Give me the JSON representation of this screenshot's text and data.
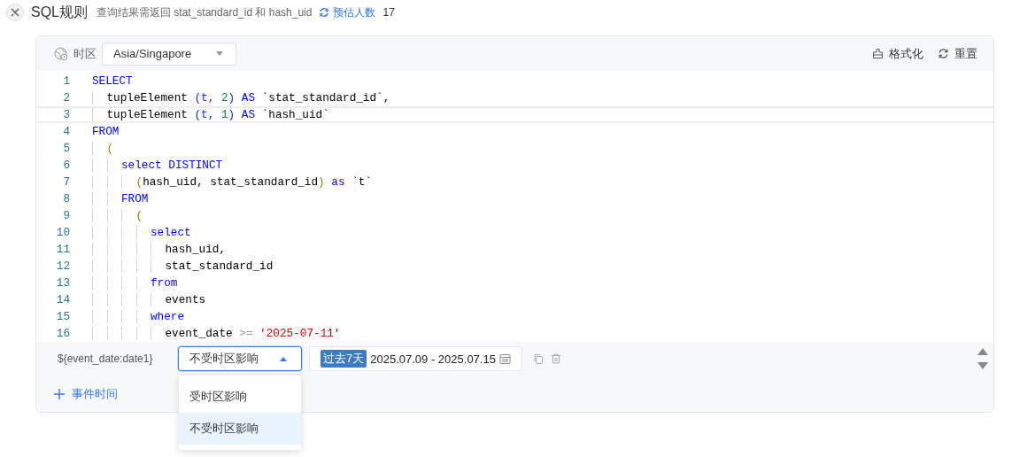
{
  "header": {
    "title": "SQL规则",
    "hint": "查询结果需返回 stat_standard_id 和 hash_uid",
    "estimate_link": "预估人数",
    "estimate_count": "17"
  },
  "toolbar": {
    "timezone_label": "时区",
    "timezone_value": "Asia/Singapore",
    "format_button": "格式化",
    "reset_button": "重置"
  },
  "code_lines": [
    {
      "number": "1",
      "current": false,
      "tokens": [
        {
          "kind": "kw",
          "text": "SELECT"
        }
      ]
    },
    {
      "number": "2",
      "current": false,
      "tokens": [
        {
          "kind": "plain",
          "text": "  tupleElement "
        },
        {
          "kind": "bracket",
          "text": "(t, "
        },
        {
          "kind": "num",
          "text": "2"
        },
        {
          "kind": "bracket",
          "text": ")"
        },
        {
          "kind": "kw",
          "text": " AS"
        },
        {
          "kind": "plain",
          "text": " `stat_standard_id`,"
        }
      ]
    },
    {
      "number": "3",
      "current": true,
      "tokens": [
        {
          "kind": "plain",
          "text": "  tupleElement "
        },
        {
          "kind": "bracket",
          "text": "(t, "
        },
        {
          "kind": "num",
          "text": "1"
        },
        {
          "kind": "bracket",
          "text": ")"
        },
        {
          "kind": "kw",
          "text": " AS"
        },
        {
          "kind": "plain",
          "text": " `hash_uid`"
        }
      ]
    },
    {
      "number": "4",
      "current": false,
      "tokens": [
        {
          "kind": "kw",
          "text": "FROM"
        }
      ]
    },
    {
      "number": "5",
      "current": false,
      "tokens": [
        {
          "kind": "paren",
          "text": "  ("
        }
      ]
    },
    {
      "number": "6",
      "current": false,
      "tokens": [
        {
          "kind": "kw",
          "text": "    select DISTINCT"
        }
      ]
    },
    {
      "number": "7",
      "current": false,
      "tokens": [
        {
          "kind": "paren",
          "text": "      ("
        },
        {
          "kind": "plain",
          "text": "hash_uid, stat_standard_id"
        },
        {
          "kind": "paren",
          "text": ")"
        },
        {
          "kind": "kw",
          "text": " as"
        },
        {
          "kind": "plain",
          "text": " `t`"
        }
      ]
    },
    {
      "number": "8",
      "current": false,
      "tokens": [
        {
          "kind": "kw",
          "text": "    FROM"
        }
      ]
    },
    {
      "number": "9",
      "current": false,
      "tokens": [
        {
          "kind": "paren",
          "text": "      ("
        }
      ]
    },
    {
      "number": "10",
      "current": false,
      "tokens": [
        {
          "kind": "kw",
          "text": "        select"
        }
      ]
    },
    {
      "number": "11",
      "current": false,
      "tokens": [
        {
          "kind": "plain",
          "text": "          hash_uid,"
        }
      ]
    },
    {
      "number": "12",
      "current": false,
      "tokens": [
        {
          "kind": "plain",
          "text": "          stat_standard_id"
        }
      ]
    },
    {
      "number": "13",
      "current": false,
      "tokens": [
        {
          "kind": "kw",
          "text": "        from"
        }
      ]
    },
    {
      "number": "14",
      "current": false,
      "tokens": [
        {
          "kind": "plain",
          "text": "          events"
        }
      ]
    },
    {
      "number": "15",
      "current": false,
      "tokens": [
        {
          "kind": "kw",
          "text": "        where"
        }
      ]
    },
    {
      "number": "16",
      "current": false,
      "tokens": [
        {
          "kind": "plain",
          "text": "          event_date "
        },
        {
          "kind": "op",
          "text": ">="
        },
        {
          "kind": "str",
          "text": " '2025-07-11'"
        }
      ]
    }
  ],
  "params": [
    {
      "variable": "${event_date:date1}",
      "mode_value": "不受时区影响",
      "expanded": true,
      "mode_options": [
        {
          "label": "受时区影响",
          "selected": false
        },
        {
          "label": "不受时区影响",
          "selected": true
        }
      ],
      "range_tag": "过去7天",
      "date_range": "2025.07.09 - 2025.07.15"
    }
  ],
  "add_button": "事件时间"
}
